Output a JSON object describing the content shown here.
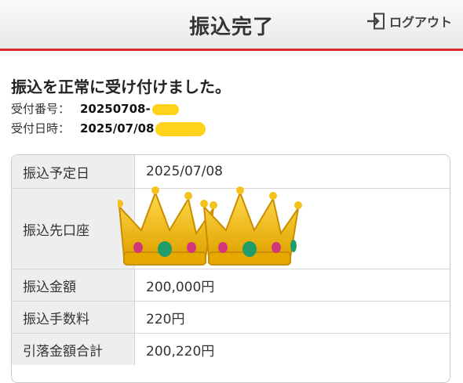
{
  "header": {
    "title": "振込完了",
    "logout_label": "ログアウト"
  },
  "status": {
    "message": "振込を正常に受け付けました。",
    "receipt_number_label": "受付番号：",
    "receipt_number_value": "20250708-",
    "receipt_datetime_label": "受付日時：",
    "receipt_datetime_value": "2025/07/08"
  },
  "details": [
    {
      "label": "振込予定日",
      "value": "2025/07/08"
    },
    {
      "label": "振込先口座",
      "value": ""
    },
    {
      "label": "振込金額",
      "value": "200,000円"
    },
    {
      "label": "振込手数料",
      "value": "220円"
    },
    {
      "label": "引落金額合計",
      "value": "200,220円"
    }
  ],
  "colors": {
    "accent_red": "#d9262c",
    "redaction": "#ffd31a",
    "crown_gold": "#f2b817"
  },
  "overlay": {
    "emoji": "crown-icon"
  }
}
